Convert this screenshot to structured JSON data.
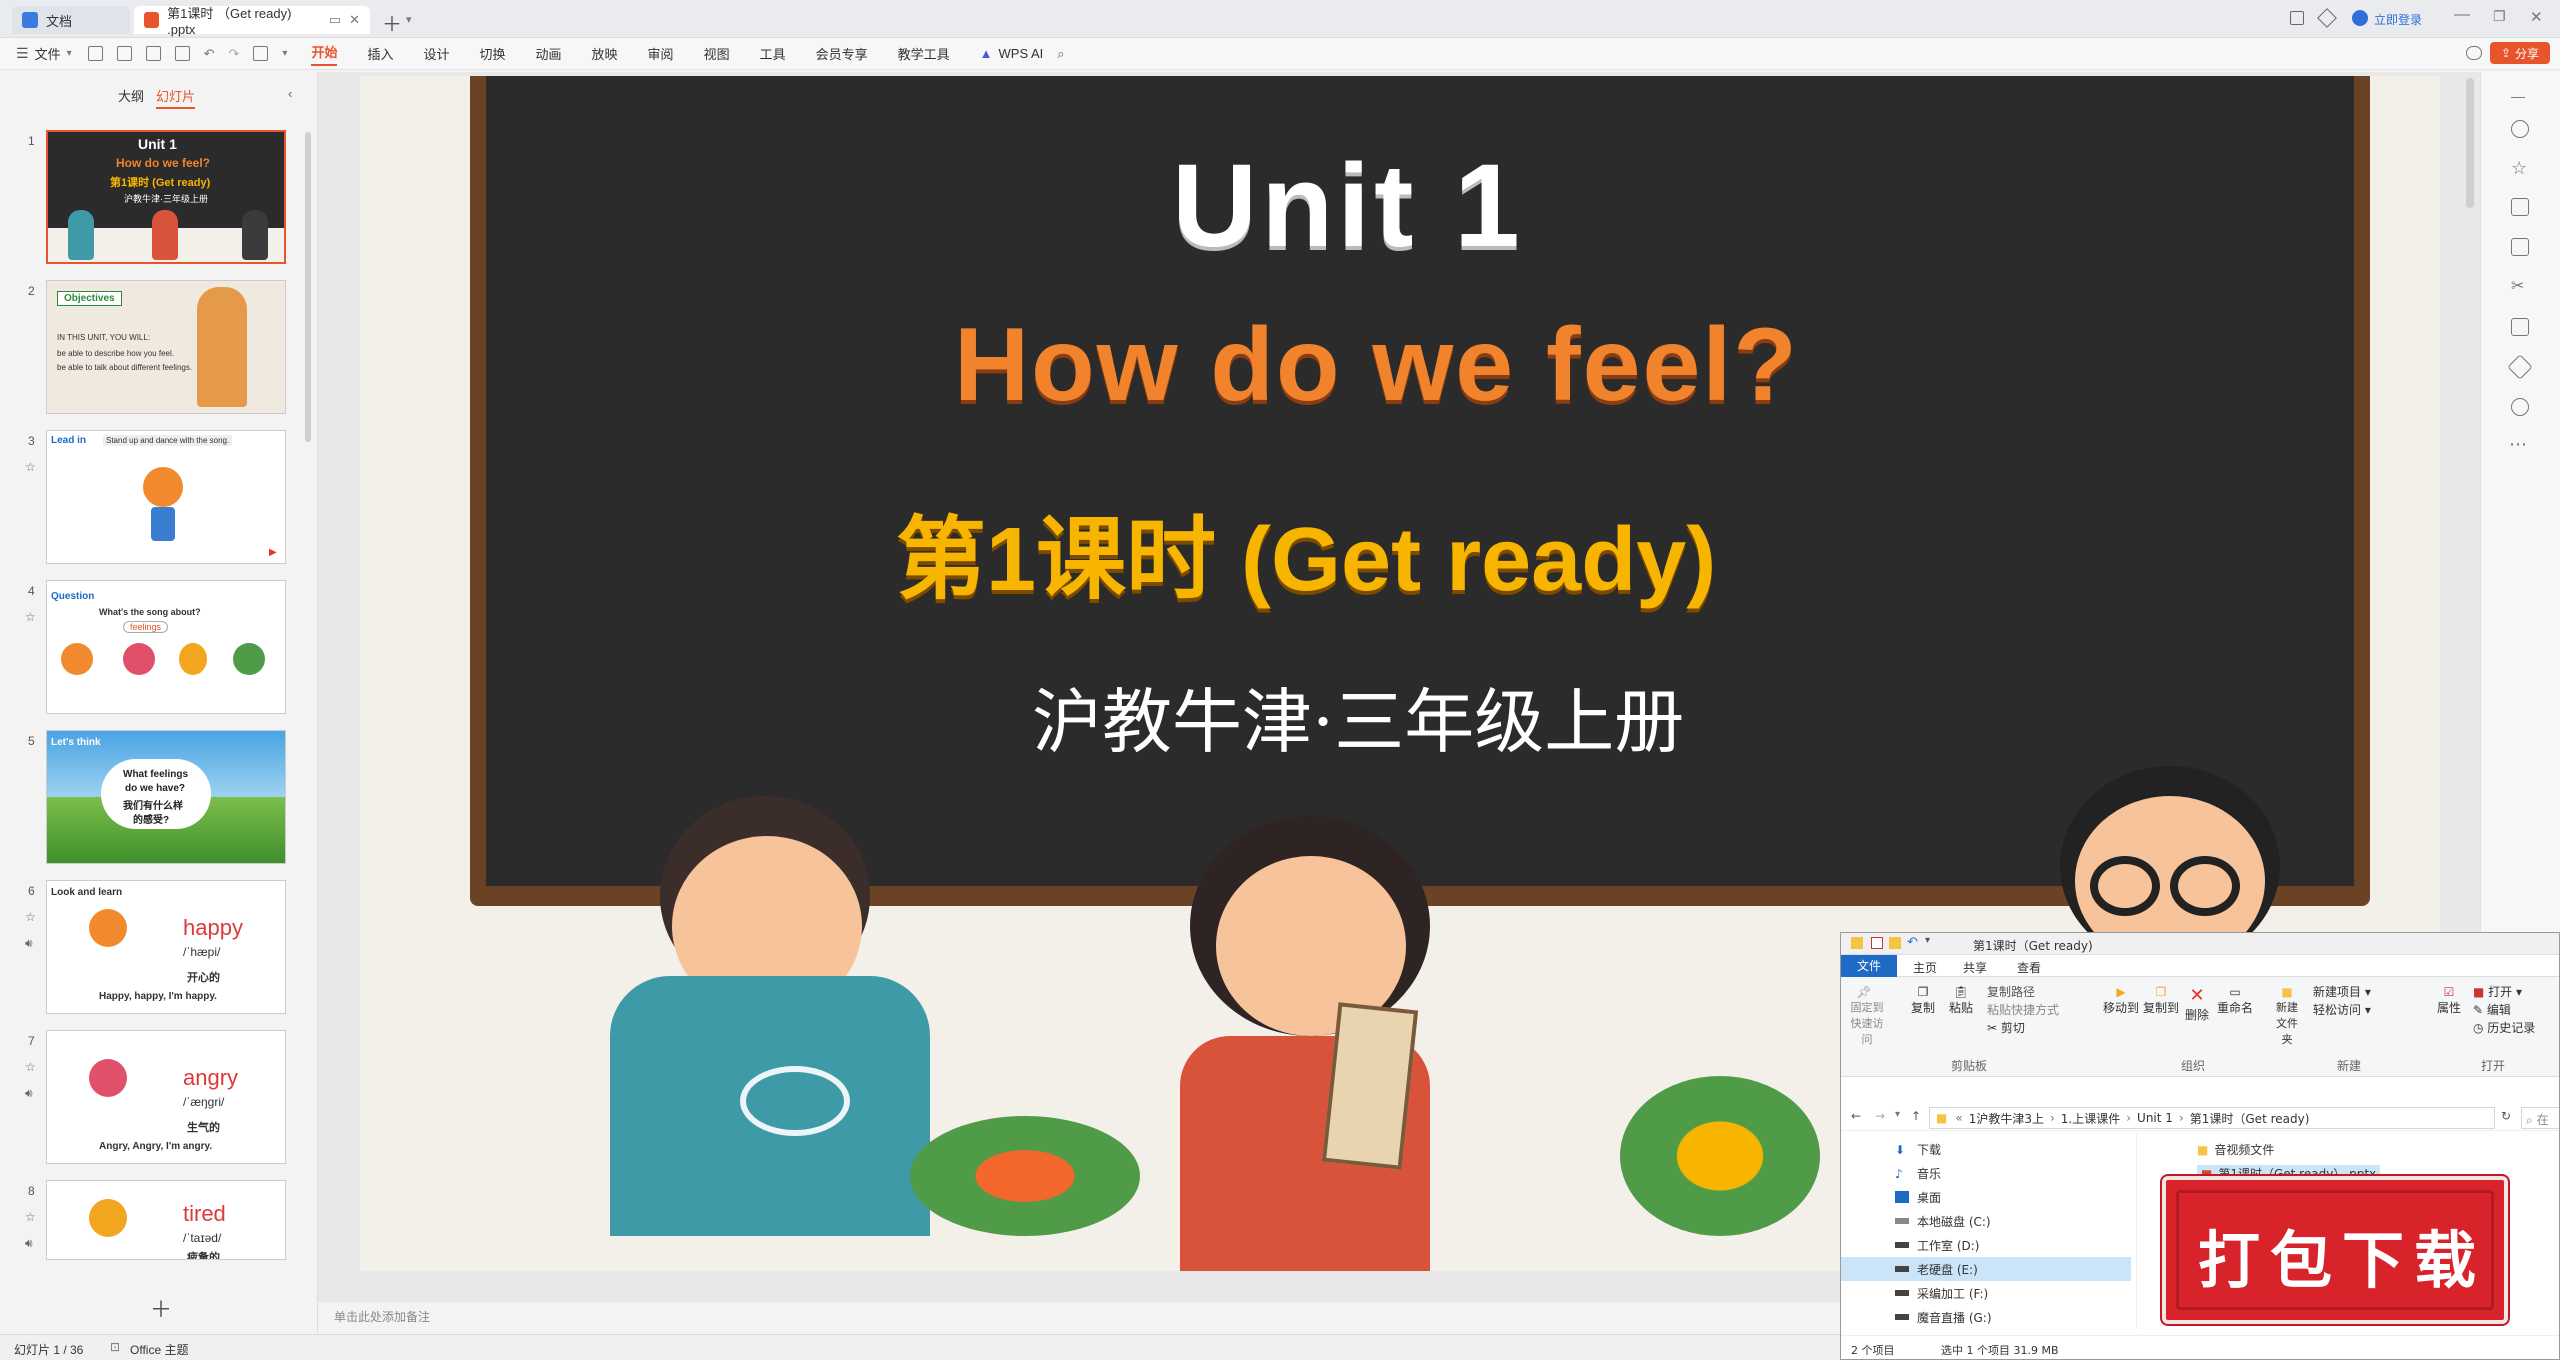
{
  "app": {
    "tabs": [
      {
        "label": "文档"
      },
      {
        "label": "第1课时 （Get ready) .pptx"
      }
    ],
    "top_right": {
      "login": "立即登录"
    }
  },
  "menu": {
    "file": "文件",
    "items": [
      "开始",
      "插入",
      "设计",
      "切换",
      "动画",
      "放映",
      "审阅",
      "视图",
      "工具",
      "会员专享",
      "教学工具",
      "WPS AI"
    ],
    "share": "分享",
    "active": "开始"
  },
  "left_panel": {
    "tabs": [
      "大纲",
      "幻灯片"
    ],
    "active_tab": "幻灯片",
    "slides": [
      {
        "num": "1",
        "lines": [
          "Unit 1",
          "How do we feel?",
          "第1课时 (Get ready)",
          "沪教牛津·三年级上册"
        ]
      },
      {
        "num": "2",
        "lines": [
          "Objectives",
          "IN THIS UNIT, YOU WILL:",
          "be able to describe how you feel.",
          "be able to talk about different feelings."
        ]
      },
      {
        "num": "3",
        "lines": [
          "Lead in",
          "Stand up and dance with the song."
        ]
      },
      {
        "num": "4",
        "lines": [
          "Question",
          "What's the song about?",
          "feelings"
        ]
      },
      {
        "num": "5",
        "lines": [
          "Let's think",
          "What feelings",
          "do we have?",
          "我们有什么样",
          "的感受?"
        ]
      },
      {
        "num": "6",
        "lines": [
          "Look and learn",
          "happy",
          "/ˈhæpi/",
          "开心的",
          "Happy, happy, I'm happy."
        ]
      },
      {
        "num": "7",
        "lines": [
          "angry",
          "/ˈæŋɡri/",
          "生气的",
          "Angry, Angry, I'm angry."
        ]
      },
      {
        "num": "8",
        "lines": [
          "tired",
          "/ˈtaɪəd/",
          "疲惫的"
        ]
      }
    ]
  },
  "slide": {
    "title": "Unit 1",
    "subtitle": "How do we feel?",
    "lesson": "第1课时 (Get ready)",
    "book": "沪教牛津·三年级上册"
  },
  "notes_placeholder": "单击此处添加备注",
  "status": {
    "slide_count": "幻灯片 1 / 36",
    "theme": "Office 主题"
  },
  "explorer": {
    "title": "第1课时（Get ready)",
    "ribbon_tabs": [
      "文件",
      "主页",
      "共享",
      "查看"
    ],
    "clipboard": {
      "pin": "固定到快速访问",
      "copy": "复制",
      "paste": "粘贴",
      "copy_path": "复制路径",
      "paste_shortcut": "粘贴快捷方式",
      "cut": "剪切",
      "group": "剪贴板"
    },
    "organize": {
      "move_to": "移动到",
      "copy_to": "复制到",
      "delete": "删除",
      "rename": "重命名",
      "group": "组织"
    },
    "new": {
      "new_folder": "新建文件夹",
      "new_item": "新建项目",
      "easy_access": "轻松访问",
      "group": "新建"
    },
    "open": {
      "properties": "属性",
      "open": "打开",
      "edit": "编辑",
      "history": "历史记录",
      "group": "打开"
    },
    "address": [
      "1沪教牛津3上",
      "1.上课课件",
      "Unit 1",
      "第1课时（Get ready)"
    ],
    "search": "在",
    "nav_items": [
      "下载",
      "音乐",
      "桌面",
      "本地磁盘 (C:)",
      "工作室 (D:)",
      "老硬盘 (E:)",
      "采编加工 (F:)",
      "魔音直播 (G:)"
    ],
    "files": [
      "音视频文件",
      "第1课时（Get ready）.pptx"
    ],
    "status_items": "2 个项目",
    "status_selected": "选中 1 个项目  31.9 MB"
  },
  "banner": {
    "text": "打包下载"
  }
}
